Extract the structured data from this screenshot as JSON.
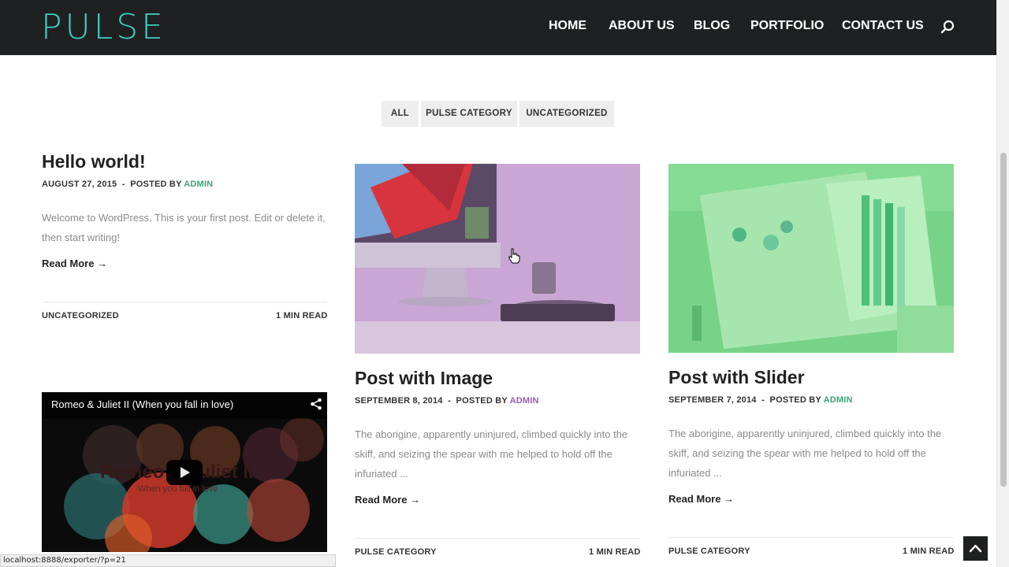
{
  "header": {
    "logo": "PULSE",
    "nav": [
      "HOME",
      "ABOUT US",
      "BLOG",
      "PORTFOLIO",
      "CONTACT US"
    ]
  },
  "filters": [
    "ALL",
    "PULSE CATEGORY",
    "UNCATEGORIZED"
  ],
  "posts": [
    {
      "title": "Hello world!",
      "date": "AUGUST 27, 2015",
      "posted_by": "POSTED BY",
      "author": "ADMIN",
      "excerpt_line1": "Welcome to WordPress. This is your first post. Edit or delete it,",
      "excerpt_line2": "then start writing!",
      "read_more": "Read More →",
      "category": "UNCATEGORIZED",
      "read_time": "1 MIN READ"
    },
    {
      "title": "Post with Image",
      "date": "SEPTEMBER 8, 2014",
      "posted_by": "POSTED BY",
      "author": "ADMIN",
      "excerpt_line1": "The aborigine, apparently uninjured, climbed quickly into the",
      "excerpt_line2": "skiff, and seizing the spear with me helped to hold off the",
      "excerpt_line3": "infuriated ...",
      "read_more": "Read More →",
      "category": "PULSE CATEGORY",
      "read_time": "1 MIN READ"
    },
    {
      "title": "Post with Slider",
      "date": "SEPTEMBER 7, 2014",
      "posted_by": "POSTED BY",
      "author": "ADMIN",
      "excerpt_line1": "The aborigine, apparently uninjured, climbed quickly into the",
      "excerpt_line2": "skiff, and seizing the spear with me helped to hold off the",
      "excerpt_line3": "infuriated ...",
      "read_more": "Read More →",
      "category": "PULSE CATEGORY",
      "read_time": "1 MIN READ"
    }
  ],
  "video": {
    "title": "Romeo & Juliet II (When you fall in love)",
    "overlay_title": "Romeo & Juliet II",
    "overlay_sub": "When you fall in love"
  },
  "status_bar": "localhost:8888/exporter/?p=21",
  "colors": {
    "header_bg": "#1f2022",
    "logo": "#3ccfbe",
    "author_green": "#3aa577",
    "author_purple": "#9b59b6"
  },
  "icons": [
    "search-icon",
    "share-icon",
    "play-icon",
    "chevron-up-icon",
    "arrow-right-icon"
  ]
}
